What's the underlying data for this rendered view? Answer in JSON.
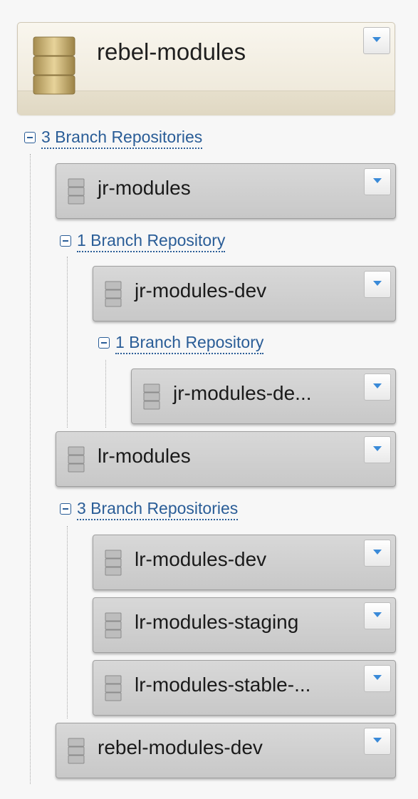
{
  "root": {
    "name": "rebel-modules",
    "icon": "database-icon"
  },
  "tree": {
    "root_children_label": "3 Branch Repositories",
    "jr_modules": {
      "name": "jr-modules",
      "children_label": "1 Branch Repository",
      "dev": {
        "name": "jr-modules-dev",
        "children_label": "1 Branch Repository",
        "child_name": "jr-modules-de..."
      }
    },
    "lr_modules": {
      "name": "lr-modules",
      "children_label": "3 Branch Repositories",
      "children": [
        "lr-modules-dev",
        "lr-modules-staging",
        "lr-modules-stable-..."
      ]
    },
    "rebel_dev": {
      "name": "rebel-modules-dev"
    }
  },
  "colors": {
    "link": "#2a5d97",
    "card": "#d0d0d0",
    "root_card": "#f3efe3"
  }
}
